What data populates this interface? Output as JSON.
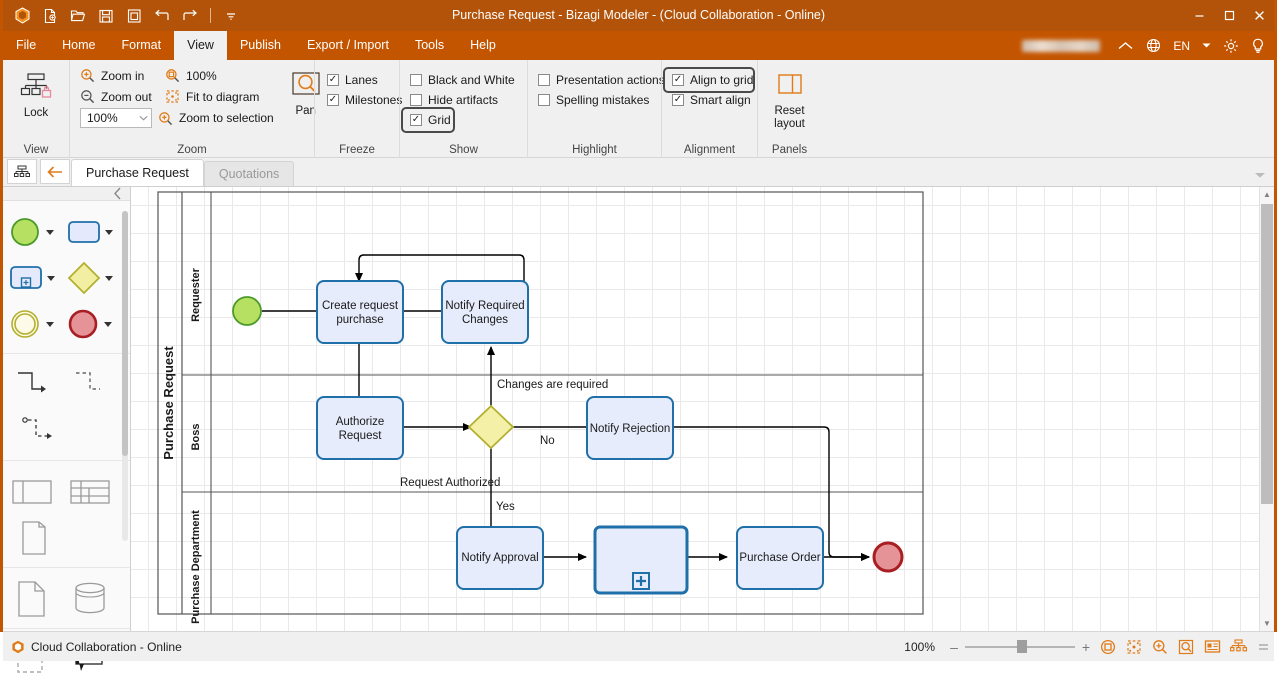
{
  "window": {
    "title": "Purchase Request - Bizagi Modeler - (Cloud Collaboration - Online)",
    "minimize": "–",
    "maximize": "☐",
    "close": "✕"
  },
  "quick_access": [
    {
      "name": "app-logo-icon",
      "label": "Bizagi"
    },
    {
      "name": "new-document-icon",
      "label": "New"
    },
    {
      "name": "open-file-icon",
      "label": "Open"
    },
    {
      "name": "save-icon",
      "label": "Save"
    },
    {
      "name": "save-as-icon",
      "label": "Save As"
    },
    {
      "name": "undo-icon",
      "label": "Undo"
    },
    {
      "name": "redo-icon",
      "label": "Redo"
    },
    {
      "name": "customize-qat-icon",
      "label": "Customize Quick Access Toolbar"
    }
  ],
  "menu": {
    "items": [
      "File",
      "Home",
      "Format",
      "View",
      "Publish",
      "Export / Import",
      "Tools",
      "Help"
    ],
    "active": "View",
    "language": "EN",
    "right_icons": [
      "collapse-ribbon-icon",
      "globe-icon",
      "language-dropdown-icon",
      "settings-gear-icon",
      "help-bulb-icon"
    ]
  },
  "ribbon": {
    "groups": [
      {
        "name": "View",
        "label": "View",
        "buttons": [
          {
            "label": "Lock",
            "icon": "lock-diagram-icon"
          }
        ]
      },
      {
        "name": "Zoom",
        "label": "Zoom",
        "items": [
          {
            "label": "Zoom in",
            "icon": "zoom-in-icon"
          },
          {
            "label": "100%",
            "icon": "actual-size-icon"
          },
          {
            "label": "Zoom out",
            "icon": "zoom-out-icon"
          },
          {
            "label": "Fit to diagram",
            "icon": "fit-to-diagram-icon"
          },
          {
            "label": "Zoom to selection",
            "icon": "zoom-to-selection-icon"
          }
        ],
        "combo_value": "100%",
        "pan": {
          "label": "Pan",
          "icon": "pan-icon"
        }
      },
      {
        "name": "Freeze",
        "label": "Freeze",
        "checkboxes": [
          {
            "label": "Lanes",
            "checked": true
          },
          {
            "label": "Milestones",
            "checked": true
          }
        ]
      },
      {
        "name": "Show",
        "label": "Show",
        "checkboxes": [
          {
            "label": "Black and White",
            "checked": false
          },
          {
            "label": "Hide artifacts",
            "checked": false
          },
          {
            "label": "Grid",
            "checked": true,
            "focused": true
          }
        ]
      },
      {
        "name": "Highlight",
        "label": "Highlight",
        "checkboxes": [
          {
            "label": "Presentation actions",
            "checked": false
          },
          {
            "label": "Spelling mistakes",
            "checked": false
          }
        ]
      },
      {
        "name": "Alignment",
        "label": "Alignment",
        "checkboxes": [
          {
            "label": "Align to grid",
            "checked": true,
            "focused": true
          },
          {
            "label": "Smart align",
            "checked": true
          }
        ]
      },
      {
        "name": "Panels",
        "label": "Panels",
        "buttons": [
          {
            "label": "Reset layout",
            "icon": "reset-layout-icon"
          }
        ]
      }
    ]
  },
  "tabstrip": {
    "diagram_list_icon": "diagram-list-icon",
    "back_icon": "back-arrow-icon",
    "tabs": [
      {
        "label": "Purchase Request",
        "active": true
      },
      {
        "label": "Quotations",
        "active": false
      }
    ],
    "overflow_icon": "chevron-down-icon"
  },
  "palette": {
    "collapse_icon": "collapse-panel-icon",
    "sections": [
      {
        "name": "events-activities",
        "shapes": [
          {
            "name": "start-event-shape",
            "label": "Start event",
            "has_dropdown": true
          },
          {
            "name": "task-shape",
            "label": "Task",
            "has_dropdown": true
          },
          {
            "name": "subprocess-shape",
            "label": "Sub-process",
            "has_dropdown": true
          },
          {
            "name": "gateway-shape",
            "label": "Gateway",
            "has_dropdown": true
          },
          {
            "name": "intermediate-event-shape",
            "label": "Intermediate event",
            "has_dropdown": true
          },
          {
            "name": "end-event-shape",
            "label": "End event",
            "has_dropdown": true
          }
        ]
      },
      {
        "name": "connectors",
        "shapes": [
          {
            "name": "sequence-flow-connector",
            "label": "Sequence flow"
          },
          {
            "name": "message-flow-connector",
            "label": "Message flow"
          },
          {
            "name": "association-connector",
            "label": "Association"
          }
        ]
      },
      {
        "name": "containers",
        "shapes": [
          {
            "name": "pool-shape",
            "label": "Pool"
          },
          {
            "name": "milestone-shape",
            "label": "Milestone"
          },
          {
            "name": "group-shape",
            "label": "Group"
          }
        ]
      },
      {
        "name": "artifacts",
        "shapes": [
          {
            "name": "data-object-shape",
            "label": "Data object"
          },
          {
            "name": "data-store-shape",
            "label": "Data store"
          }
        ]
      },
      {
        "name": "annotations",
        "shapes": [
          {
            "name": "dashed-box-shape",
            "label": "Dashed container"
          },
          {
            "name": "annotation-shape",
            "label": "Annotation"
          }
        ]
      }
    ]
  },
  "diagram": {
    "pool_label": "Purchase Request",
    "lanes": [
      "Requester",
      "Boss",
      "Purchase Department"
    ],
    "nodes": [
      {
        "id": "start",
        "type": "start-event",
        "label": "",
        "lane": "Requester"
      },
      {
        "id": "create",
        "type": "task",
        "label": "Create request purchase",
        "lane": "Requester"
      },
      {
        "id": "notify_changes",
        "type": "task",
        "label": "Notify Required Changes",
        "lane": "Requester"
      },
      {
        "id": "authorize",
        "type": "task",
        "label": "Authorize Request",
        "lane": "Boss"
      },
      {
        "id": "gateway",
        "type": "exclusive-gateway",
        "label": "",
        "lane": "Boss"
      },
      {
        "id": "notify_rejection",
        "type": "task",
        "label": "Notify Rejection",
        "lane": "Boss"
      },
      {
        "id": "notify_approval",
        "type": "task",
        "label": "Notify Approval",
        "lane": "Purchase Department"
      },
      {
        "id": "subprocess",
        "type": "sub-process",
        "label": "",
        "lane": "Purchase Department",
        "selected": true
      },
      {
        "id": "purchase_order",
        "type": "task",
        "label": "Purchase Order",
        "lane": "Purchase Department"
      },
      {
        "id": "end",
        "type": "end-event",
        "label": "",
        "lane": "Purchase Department"
      }
    ],
    "flow_labels": [
      {
        "text": "Changes are required"
      },
      {
        "text": "No"
      },
      {
        "text": "Request Authorized"
      },
      {
        "text": "Yes"
      }
    ]
  },
  "statusbar": {
    "connection_icon": "bizagi-cloud-icon",
    "connection_text": "Cloud Collaboration - Online",
    "zoom_level": "100%",
    "zoom_out_label": "–",
    "zoom_in_label": "+",
    "view_icons": [
      "actual-size-icon",
      "fit-to-diagram-icon",
      "zoom-in-icon",
      "zoom-to-selection-icon",
      "presentation-view-icon",
      "diagram-list-icon"
    ]
  }
}
